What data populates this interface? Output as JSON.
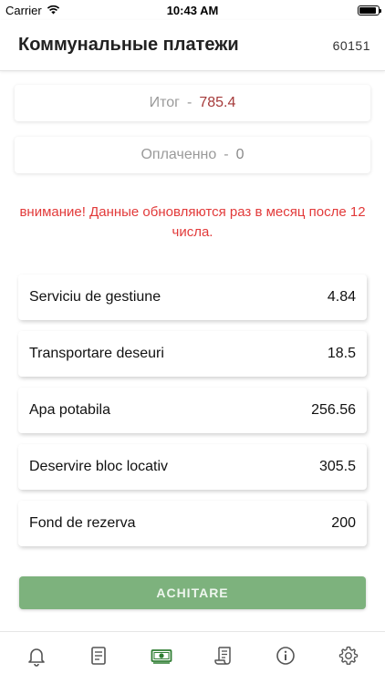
{
  "status_bar": {
    "carrier": "Carrier",
    "time": "10:43 AM",
    "battery_level": 0.9
  },
  "header": {
    "title": "Коммунальные платежи",
    "account_id": "60151"
  },
  "summary": {
    "total_label": "Итог",
    "separator": "-",
    "total_value": "785.4",
    "paid_label": "Оплаченно",
    "paid_value": "0"
  },
  "notice": "внимание! Данные обновляются раз в месяц после 12 числа.",
  "items": [
    {
      "label": "Serviciu de gestiune",
      "value": "4.84"
    },
    {
      "label": "Transportare deseuri",
      "value": "18.5"
    },
    {
      "label": "Apa potabila",
      "value": "256.56"
    },
    {
      "label": "Deservire bloc locativ",
      "value": "305.5"
    },
    {
      "label": "Fond de rezerva",
      "value": "200"
    }
  ],
  "pay_button": {
    "label": "ACHITARE"
  },
  "tabs": [
    {
      "icon": "bell-icon",
      "active": false
    },
    {
      "icon": "document-icon",
      "active": false
    },
    {
      "icon": "money-icon",
      "active": true
    },
    {
      "icon": "receipt-icon",
      "active": false
    },
    {
      "icon": "info-icon",
      "active": false
    },
    {
      "icon": "gear-icon",
      "active": false
    }
  ],
  "colors": {
    "accent_green": "#2e7d32",
    "button_green": "#7db27d",
    "notice_red": "#e23a3a",
    "total_red": "#a53a3a"
  }
}
